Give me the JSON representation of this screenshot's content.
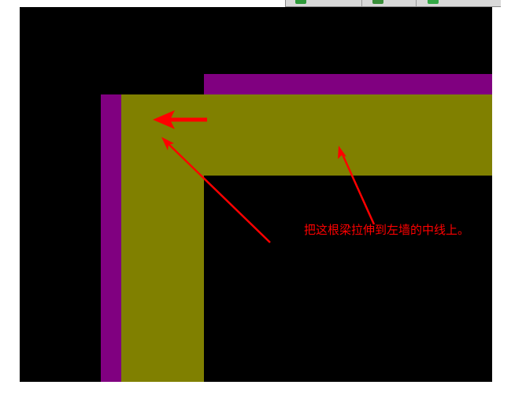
{
  "toolbar": {
    "buttons": [
      {
        "icon": "green-select-icon",
        "color": "#2e9b3a"
      },
      {
        "icon": "green-grid-icon",
        "color": "#3a8f3a"
      },
      {
        "icon": "green-layer-icon",
        "color": "#33a845"
      }
    ]
  },
  "canvas": {
    "background": "#000000",
    "wall_color": "#800080",
    "beam_color": "#808000"
  },
  "annotation": {
    "text": "把这根梁拉伸到左墙的中线上。",
    "color": "#ff0000"
  }
}
